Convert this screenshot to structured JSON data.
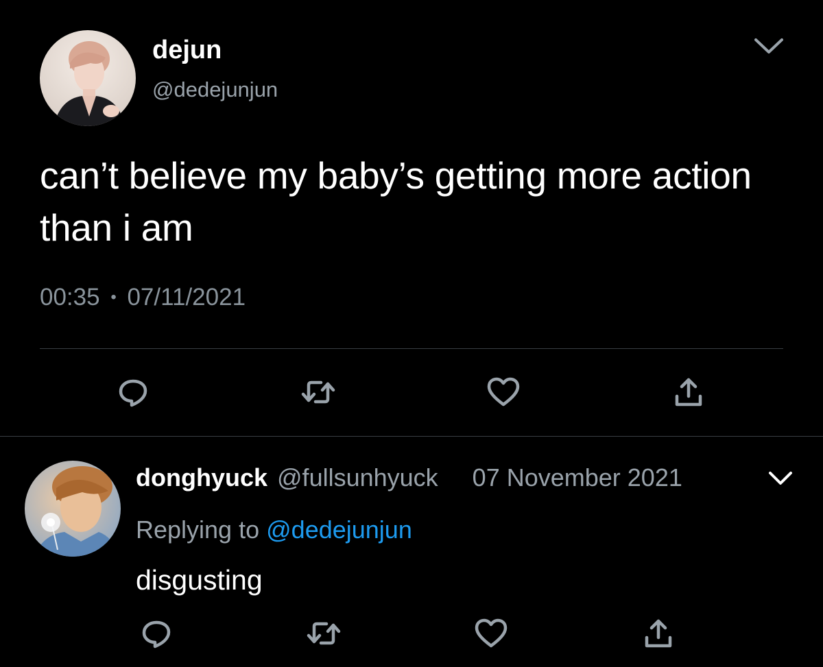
{
  "tweet": {
    "display_name": "dejun",
    "handle": "@dedejunjun",
    "text": "can’t believe my baby’s getting more action than i am",
    "time": "00:35",
    "separator": "•",
    "date": "07/11/2021",
    "avatar": "profile-photo"
  },
  "reply": {
    "display_name": "donghyuck",
    "handle": "@fullsunhyuck",
    "date": "07 November 2021",
    "replying_prefix": "Replying to",
    "replying_to": "@dedejunjun",
    "text": "disgusting",
    "avatar": "profile-photo"
  },
  "icons": {
    "reply": "speech-bubble-icon",
    "retweet": "retweet-icon",
    "like": "heart-icon",
    "share": "share-icon",
    "menu": "chevron-down-icon"
  },
  "colors": {
    "background": "#000000",
    "text": "#ffffff",
    "secondary": "#9aa3ab",
    "link": "#1d9bf0",
    "divider": "#3a3f44",
    "icon": "#9aa3ab"
  }
}
